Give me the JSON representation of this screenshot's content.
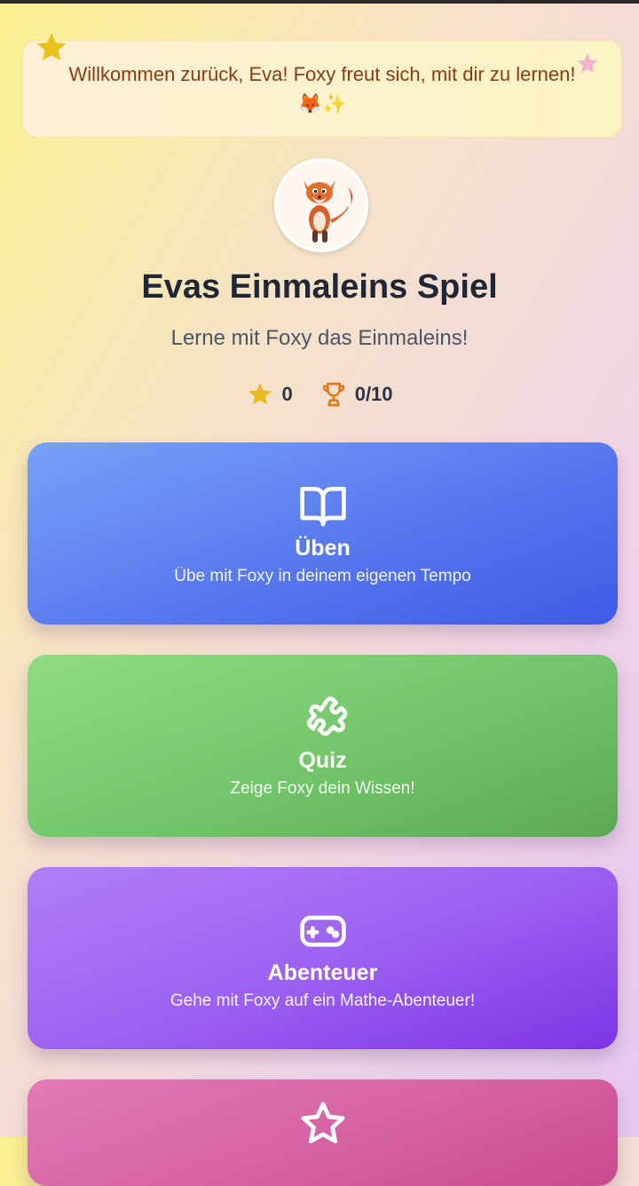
{
  "banner": {
    "text": "Willkommen zurück, Eva! Foxy freut sich, mit dir zu lernen! 🦊✨"
  },
  "header": {
    "title": "Evas Einmaleins Spiel",
    "subtitle": "Lerne mit Foxy das Einmaleins!"
  },
  "stats": {
    "stars": "0",
    "trophies": "0/10"
  },
  "cards": [
    {
      "label": "Üben",
      "description": "Übe mit Foxy in deinem eigenen Tempo",
      "icon": "book-icon"
    },
    {
      "label": "Quiz",
      "description": "Zeige Foxy dein Wissen!",
      "icon": "puzzle-icon"
    },
    {
      "label": "Abenteuer",
      "description": "Gehe mit Foxy auf ein Mathe-Abenteuer!",
      "icon": "gamepad-icon"
    },
    {
      "label": "",
      "description": "",
      "icon": "star-icon"
    }
  ],
  "colors": {
    "banner_text": "#8a3b12",
    "practice": "#5878ee",
    "quiz": "#72c56a",
    "adventure": "#9a5ff0",
    "achievements": "#d45fa0",
    "star": "#e8b923",
    "trophy": "#e07a1f"
  }
}
